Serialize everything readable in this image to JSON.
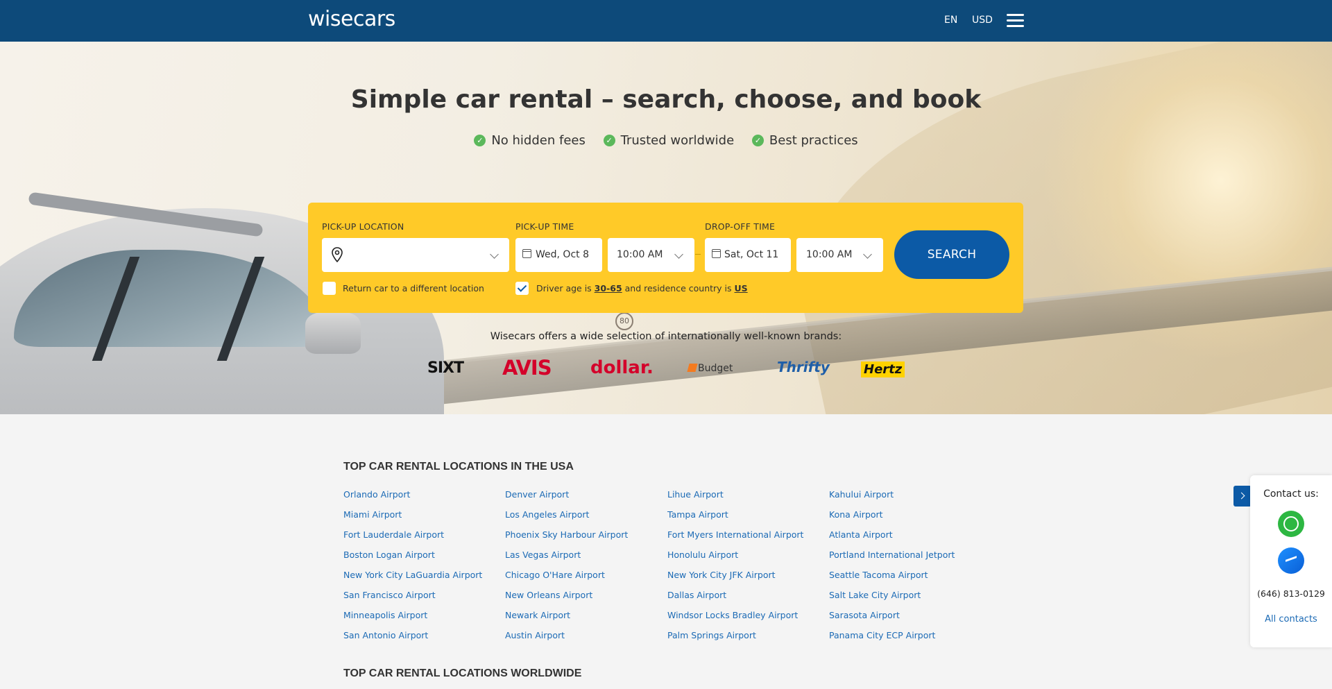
{
  "header": {
    "logo": "wisecars",
    "language": "EN",
    "currency": "USD"
  },
  "hero": {
    "title": "Simple car rental – search, choose, and book",
    "features": [
      "No hidden fees",
      "Trusted worldwide",
      "Best practices"
    ],
    "road_sign": "80"
  },
  "search": {
    "pickup_location_label": "PICK-UP LOCATION",
    "pickup_location_value": "",
    "pickup_time_label": "PICK-UP TIME",
    "pickup_date": "Wed, Oct 8",
    "pickup_hour": "10:00 AM",
    "dropoff_time_label": "DROP-OFF TIME",
    "dropoff_date": "Sat, Oct 11",
    "dropoff_hour": "10:00 AM",
    "search_button": "SEARCH",
    "return_different_label": "Return car to a different location",
    "return_different_checked": false,
    "driver_text_1": "Driver age is",
    "driver_age": "30-65",
    "driver_text_2": "and residence country is",
    "residence_country": "US",
    "driver_checked": true
  },
  "brands": {
    "intro": "Wisecars offers a wide selection of internationally well-known brands:",
    "items": [
      "SIXT",
      "AVIS",
      "dollar.",
      "Budget",
      "Thrifty",
      "Hertz"
    ]
  },
  "locations_usa": {
    "title": "TOP CAR RENTAL LOCATIONS IN THE USA",
    "columns": [
      [
        "Orlando Airport",
        "Miami Airport",
        "Fort Lauderdale Airport",
        "Boston Logan Airport",
        "New York City LaGuardia Airport",
        "San Francisco Airport",
        "Minneapolis Airport",
        "San Antonio Airport"
      ],
      [
        "Denver Airport",
        "Los Angeles Airport",
        "Phoenix Sky Harbour Airport",
        "Las Vegas Airport",
        "Chicago O'Hare Airport",
        "New Orleans Airport",
        "Newark Airport",
        "Austin Airport"
      ],
      [
        "Lihue Airport",
        "Tampa Airport",
        "Fort Myers International Airport",
        "Honolulu Airport",
        "New York City JFK Airport",
        "Dallas Airport",
        "Windsor Locks Bradley Airport",
        "Palm Springs Airport"
      ],
      [
        "Kahului Airport",
        "Kona Airport",
        "Atlanta Airport",
        "Portland International Jetport",
        "Seattle Tacoma Airport",
        "Salt Lake City Airport",
        "Sarasota Airport",
        "Panama City ECP Airport"
      ]
    ]
  },
  "locations_world": {
    "title": "TOP CAR RENTAL LOCATIONS WORLDWIDE"
  },
  "contact": {
    "title": "Contact us:",
    "phone": "(646) 813-0129",
    "all_contacts": "All contacts"
  },
  "colors": {
    "header_bg": "#0d4a7a",
    "search_panel": "#ffca28",
    "search_button": "#0c5aa6",
    "link": "#1b6ab5",
    "check": "#5bb85b"
  }
}
